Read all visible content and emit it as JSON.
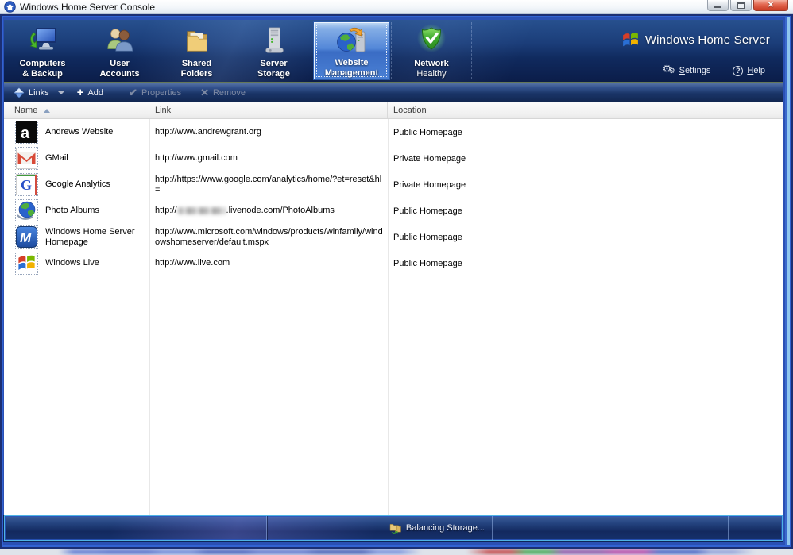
{
  "titlebar": {
    "title": "Windows Home Server Console"
  },
  "nav": {
    "tabs": [
      {
        "line1": "Computers",
        "line2": "& Backup",
        "icon": "computers-backup-icon"
      },
      {
        "line1": "User",
        "line2": "Accounts",
        "icon": "user-accounts-icon"
      },
      {
        "line1": "Shared",
        "line2": "Folders",
        "icon": "shared-folders-icon"
      },
      {
        "line1": "Server",
        "line2": "Storage",
        "icon": "server-storage-icon"
      },
      {
        "line1": "Website",
        "line2": "Management",
        "icon": "website-management-icon",
        "selected": true
      }
    ],
    "network": {
      "line1": "Network",
      "line2": "Healthy",
      "icon": "network-health-shield-icon"
    },
    "brand": "Windows Home Server",
    "settings_label": "Settings",
    "help_label": "Help"
  },
  "toolbar": {
    "links_label": "Links",
    "add_label": "Add",
    "properties_label": "Properties",
    "remove_label": "Remove"
  },
  "table": {
    "columns": [
      "Name",
      "Link",
      "Location"
    ],
    "sort": {
      "column": "Name",
      "direction": "ascending"
    },
    "rows": [
      {
        "icon": "a-logo-icon",
        "name": "Andrews Website",
        "link": "http://www.andrewgrant.org",
        "location": "Public Homepage"
      },
      {
        "icon": "gmail-icon",
        "name": "GMail",
        "link": "http://www.gmail.com",
        "location": "Private Homepage"
      },
      {
        "icon": "google-icon",
        "name": "Google Analytics",
        "link": "http://https://www.google.com/analytics/home/?et=reset&hl=",
        "location": "Private Homepage"
      },
      {
        "icon": "globe-icon",
        "name": "Photo Albums",
        "link_prefix": "http://",
        "link_suffix": ".livenode.com/PhotoAlbums",
        "location": "Public Homepage"
      },
      {
        "icon": "m-logo-icon",
        "name": "Windows Home Server Homepage",
        "link": "http://www.microsoft.com/windows/products/winfamily/windowshomeserver/default.mspx",
        "location": "Public Homepage"
      },
      {
        "icon": "windows-flag-icon",
        "name": "Windows Live",
        "link": "http://www.live.com",
        "location": "Public Homepage"
      }
    ]
  },
  "statusbar": {
    "balancing_label": "Balancing Storage..."
  },
  "colors": {
    "frame_blue": "#2a50b4",
    "nav_navy": "#102a5e",
    "accent_cyan": "#2fb8e8",
    "selected_tab_blue": "#5387d8",
    "healthy_green": "#3aa82c",
    "close_red": "#c83a22"
  }
}
